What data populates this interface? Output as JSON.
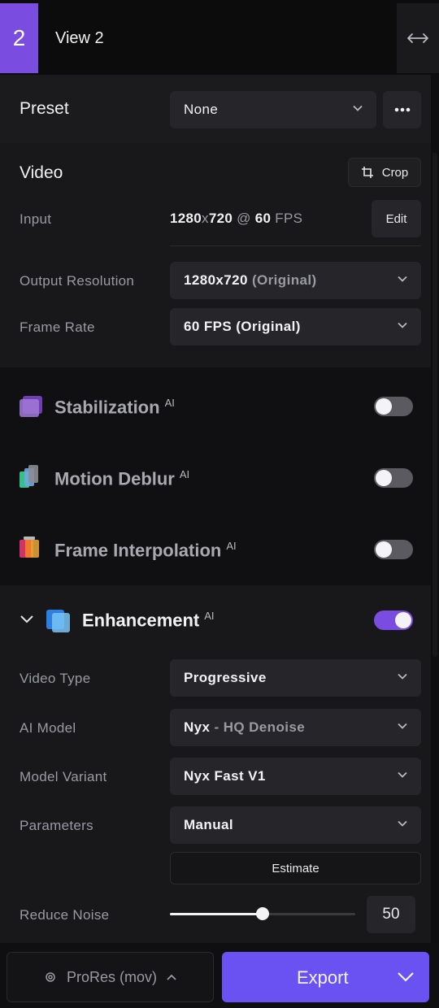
{
  "header": {
    "view_number": "2",
    "view_title": "View 2"
  },
  "preset": {
    "label": "Preset",
    "value": "None"
  },
  "video": {
    "title": "Video",
    "crop_label": "Crop",
    "input_label": "Input",
    "input_width": "1280",
    "input_height": "720",
    "input_fps": "60",
    "fps_unit": "FPS",
    "edit_label": "Edit",
    "output_resolution_label": "Output Resolution",
    "output_resolution_value": "1280x720",
    "output_resolution_suffix": "(Original)",
    "frame_rate_label": "Frame Rate",
    "frame_rate_value": "60 FPS (Original)"
  },
  "ai_features": [
    {
      "name": "Stabilization",
      "badge": "AI",
      "enabled": false
    },
    {
      "name": "Motion Deblur",
      "badge": "AI",
      "enabled": false
    },
    {
      "name": "Frame Interpolation",
      "badge": "AI",
      "enabled": false
    }
  ],
  "enhancement": {
    "title": "Enhancement",
    "badge": "AI",
    "enabled": true,
    "video_type_label": "Video Type",
    "video_type_value": "Progressive",
    "ai_model_label": "AI Model",
    "ai_model_name": "Nyx",
    "ai_model_variant_desc": "- HQ Denoise",
    "model_variant_label": "Model Variant",
    "model_variant_value": "Nyx Fast V1",
    "parameters_label": "Parameters",
    "parameters_value": "Manual",
    "estimate_label": "Estimate",
    "reduce_noise_label": "Reduce Noise",
    "reduce_noise_value": "50"
  },
  "footer": {
    "format_label": "ProRes (mov)",
    "export_label": "Export"
  },
  "colors": {
    "accent": "#7a4ce0",
    "export": "#6a52f2"
  }
}
